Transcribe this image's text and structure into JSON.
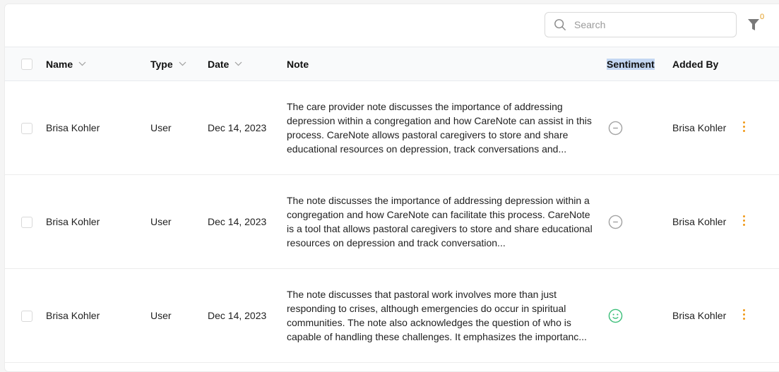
{
  "search": {
    "placeholder": "Search",
    "value": ""
  },
  "filter": {
    "icon": "filter-icon",
    "count": "0"
  },
  "table": {
    "columns": [
      {
        "key": "select",
        "label": ""
      },
      {
        "key": "name",
        "label": "Name",
        "sortable": true
      },
      {
        "key": "type",
        "label": "Type",
        "sortable": true
      },
      {
        "key": "date",
        "label": "Date",
        "sortable": true
      },
      {
        "key": "note",
        "label": "Note"
      },
      {
        "key": "sentiment",
        "label": "Sentiment",
        "highlighted": true
      },
      {
        "key": "added_by",
        "label": "Added By"
      }
    ],
    "rows": [
      {
        "name": "Brisa Kohler",
        "type": "User",
        "date": "Dec 14, 2023",
        "note": "The care provider note discusses the importance of addressing depression within a congregation and how CareNote can assist in this process. CareNote allows pastoral caregivers to store and share educational resources on depression, track conversations and...",
        "sentiment": "neutral",
        "added_by": "Brisa Kohler"
      },
      {
        "name": "Brisa Kohler",
        "type": "User",
        "date": "Dec 14, 2023",
        "note": "The note discusses the importance of addressing depression within a congregation and how CareNote can facilitate this process. CareNote is a tool that allows pastoral caregivers to store and share educational resources on depression and track conversation...",
        "sentiment": "neutral",
        "added_by": "Brisa Kohler"
      },
      {
        "name": "Brisa Kohler",
        "type": "User",
        "date": "Dec 14, 2023",
        "note": "The note discusses that pastoral work involves more than just responding to crises, although emergencies do occur in spiritual communities. The note also acknowledges the question of who is capable of handling these challenges. It emphasizes the importanc...",
        "sentiment": "positive",
        "added_by": "Brisa Kohler"
      }
    ]
  },
  "colors": {
    "neutral": "#a3a3a3",
    "positive": "#3dbf7a",
    "accent": "#f09a1a",
    "highlight": "#c4d7f2"
  }
}
